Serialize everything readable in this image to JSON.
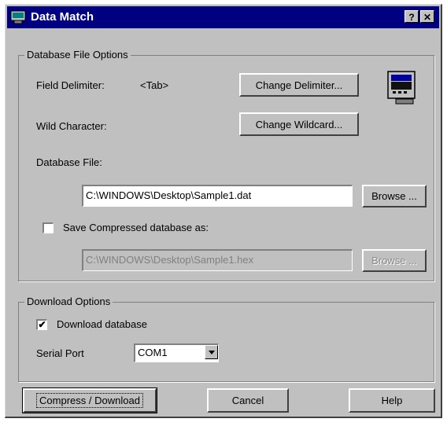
{
  "window": {
    "title": "Data Match",
    "help_glyph": "?",
    "close_glyph": "✕"
  },
  "database_options": {
    "legend": "Database File Options",
    "field_delimiter_label": "Field Delimiter:",
    "field_delimiter_value": "<Tab>",
    "change_delimiter_button": "Change Delimiter...",
    "wild_character_label": "Wild Character:",
    "change_wildcard_button": "Change Wildcard...",
    "database_file_label": "Database File:",
    "database_file_value": "C:\\WINDOWS\\Desktop\\Sample1.dat",
    "browse_button": "Browse ...",
    "save_compressed_label": "Save Compressed database as:",
    "save_compressed_checked": false,
    "compressed_file_value": "C:\\WINDOWS\\Desktop\\Sample1.hex",
    "browse_compressed_button": "Browse ..."
  },
  "download_options": {
    "legend": "Download Options",
    "download_database_label": "Download database",
    "download_database_checked": true,
    "serial_port_label": "Serial Port",
    "serial_port_value": "COM1"
  },
  "footer": {
    "compress_download_button": "Compress / Download",
    "cancel_button": "Cancel",
    "help_button": "Help"
  },
  "icons": {
    "app": "data-match-app-icon",
    "device": "handheld-device-icon",
    "checkmark": "✔"
  }
}
